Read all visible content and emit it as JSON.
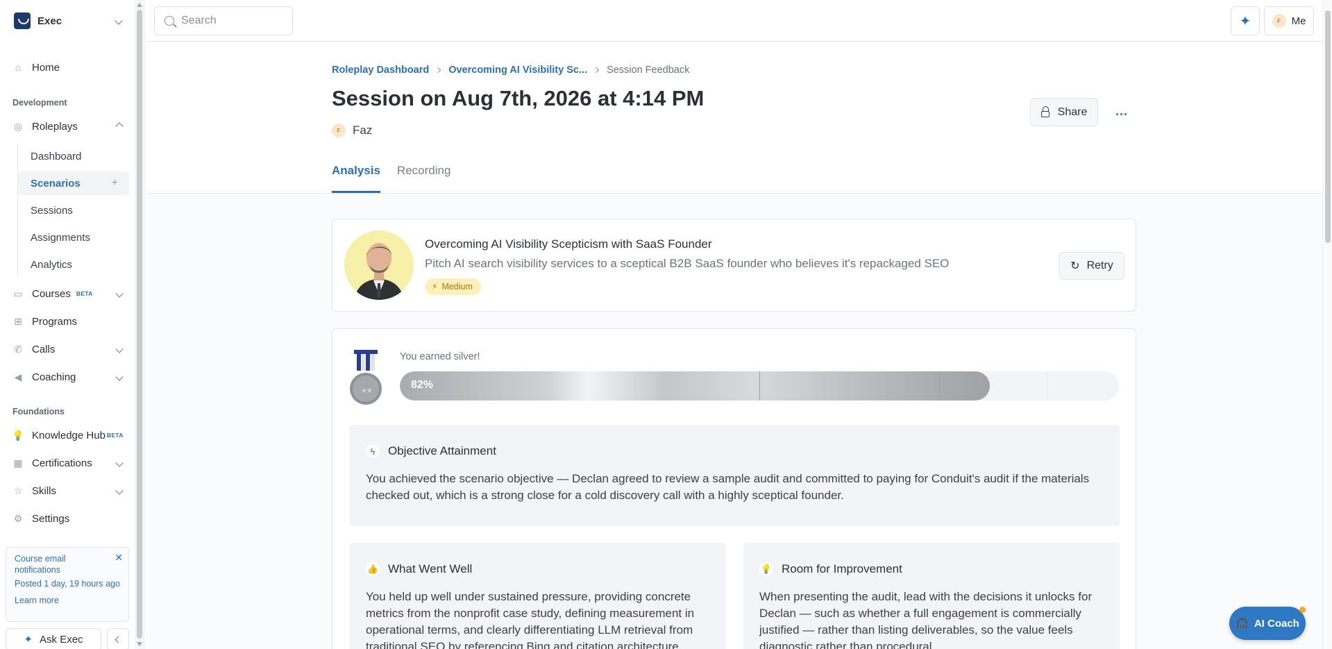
{
  "workspace": {
    "name": "Exec"
  },
  "nav": {
    "home": "Home",
    "section_development": "Development",
    "roleplays": "Roleplays",
    "roleplay_sub": [
      "Dashboard",
      "Scenarios",
      "Sessions",
      "Assignments",
      "Analytics"
    ],
    "courses": "Courses",
    "courses_badge": "BETA",
    "programs": "Programs",
    "calls": "Calls",
    "coaching": "Coaching",
    "section_foundations": "Foundations",
    "knowledge_hub": "Knowledge Hub",
    "knowledge_badge": "BETA",
    "certifications": "Certifications",
    "skills": "Skills",
    "settings": "Settings"
  },
  "notice": {
    "title": "Course email notifications",
    "posted": "Posted 1 day, 19 hours ago",
    "link": "Learn more"
  },
  "ask": {
    "label": "Ask Exec"
  },
  "topbar": {
    "search_placeholder": "Search",
    "me_label": "Me",
    "me_initial": "F"
  },
  "breadcrumb": {
    "items": [
      "Roleplay Dashboard",
      "Overcoming AI Visibility Sc...",
      "Session Feedback"
    ]
  },
  "page": {
    "title": "Session on Aug 7th, 2026 at 4:14 PM",
    "owner": "Faz",
    "owner_initial": "F",
    "share_label": "Share",
    "more_label": "..."
  },
  "tabs": [
    "Analysis",
    "Recording"
  ],
  "scenario": {
    "title": "Overcoming AI Visibility Scepticism with SaaS Founder",
    "description": "Pitch AI search visibility services to a sceptical B2B SaaS founder who believes it's repackaged SEO",
    "difficulty": "Medium",
    "retry_label": "Retry"
  },
  "score": {
    "earned_text": "You earned silver!",
    "percent_label": "82%",
    "percent": 82,
    "medal": "silver"
  },
  "objective": {
    "title": "Objective Attainment",
    "text": "You achieved the scenario objective — Declan agreed to review a sample audit and committed to paying for Conduit's audit if the materials checked out, which is a strong close for a cold discovery call with a highly sceptical founder."
  },
  "went_well": {
    "title": "What Went Well",
    "text": "You held up well under sustained pressure, providing concrete metrics from the nonprofit case study, defining measurement in operational terms, and clearly differentiating LLM retrieval from traditional SEO by referencing Bing and citation architecture."
  },
  "improve": {
    "title": "Room for Improvement",
    "text": "When presenting the audit, lead with the decisions it unlocks for Declan — such as whether a full engagement is commercially justified — rather than listing deliverables, so the value feels diagnostic rather than procedural."
  },
  "coach": {
    "label": "AI Coach"
  },
  "colors": {
    "accent": "#2f6fb0",
    "difficulty_bg": "#fdf0b8",
    "coach": "#2f78c4"
  }
}
